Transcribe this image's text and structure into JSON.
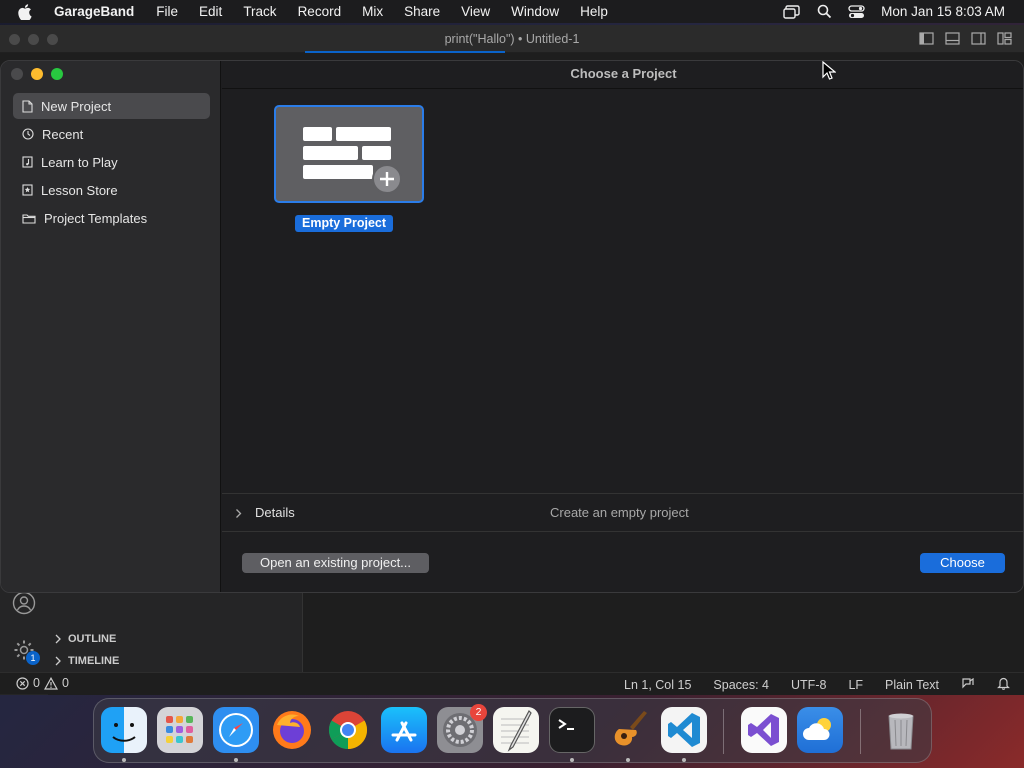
{
  "menubar": {
    "app_name": "GarageBand",
    "items": [
      "File",
      "Edit",
      "Track",
      "Record",
      "Mix",
      "Share",
      "View",
      "Window",
      "Help"
    ],
    "clock": "Mon Jan 15  8:03 AM"
  },
  "vscode": {
    "window_title": "print(\"Hallo\") • Untitled-1",
    "outline_label": "OUTLINE",
    "timeline_label": "TIMELINE",
    "settings_badge": "1",
    "errors_count": "0",
    "warnings_count": "0",
    "status": {
      "position": "Ln 1, Col 15",
      "spaces": "Spaces: 4",
      "encoding": "UTF-8",
      "eol": "LF",
      "language": "Plain Text"
    }
  },
  "dialog": {
    "header_title": "Choose a Project",
    "sidebar_items": [
      {
        "label": "New Project",
        "icon": "document-icon"
      },
      {
        "label": "Recent",
        "icon": "clock-icon"
      },
      {
        "label": "Learn to Play",
        "icon": "music-note-icon"
      },
      {
        "label": "Lesson Store",
        "icon": "star-icon"
      },
      {
        "label": "Project Templates",
        "icon": "folder-icon"
      }
    ],
    "tile_label": "Empty Project",
    "details_label": "Details",
    "details_description": "Create an empty project",
    "open_button": "Open an existing project...",
    "choose_button": "Choose"
  },
  "dock": {
    "system_settings_badge": "2",
    "apps": [
      "finder-icon",
      "launchpad-icon",
      "safari-icon",
      "firefox-icon",
      "chrome-icon",
      "app-store-icon",
      "system-settings-icon",
      "textedit-icon",
      "terminal-icon",
      "garageband-icon",
      "vscode-icon",
      "visual-studio-icon",
      "weather-icon",
      "trash-icon"
    ]
  },
  "colors": {
    "accent": "#1a6ddb",
    "close": "#ff5f57",
    "minimize": "#febc2e",
    "maximize": "#28c840"
  }
}
